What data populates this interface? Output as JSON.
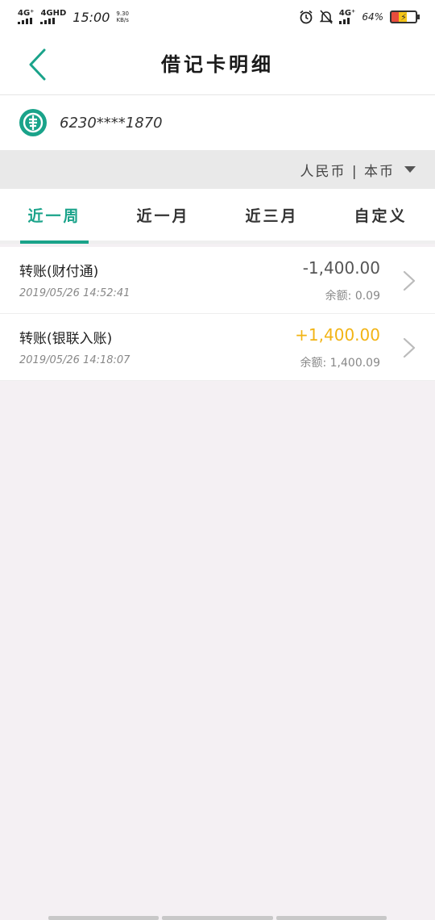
{
  "status_bar": {
    "network_1": "4G⁺",
    "network_2": "4GHD",
    "time": "15:00",
    "speed_value": "9.30",
    "speed_unit": "KB/s",
    "network_3": "4G⁺",
    "battery_percent": "64%"
  },
  "nav": {
    "title": "借记卡明细"
  },
  "card": {
    "number": "6230****1870"
  },
  "currency": {
    "label": "人民币 | 本币"
  },
  "tabs": [
    {
      "label": "近一周",
      "active": true
    },
    {
      "label": "近一月",
      "active": false
    },
    {
      "label": "近三月",
      "active": false
    },
    {
      "label": "自定义",
      "active": false
    }
  ],
  "transactions": [
    {
      "title": "转账(财付通)",
      "time": "2019/05/26 14:52:41",
      "amount": "-1,400.00",
      "balance": "余额:  0.09"
    },
    {
      "title": "转账(银联入账)",
      "time": "2019/05/26 14:18:07",
      "amount": "+1,400.00",
      "balance": "余额:  1,400.09"
    }
  ],
  "colors": {
    "accent": "#1aa38a",
    "income": "#f2b415",
    "background": "#f4f0f3"
  }
}
